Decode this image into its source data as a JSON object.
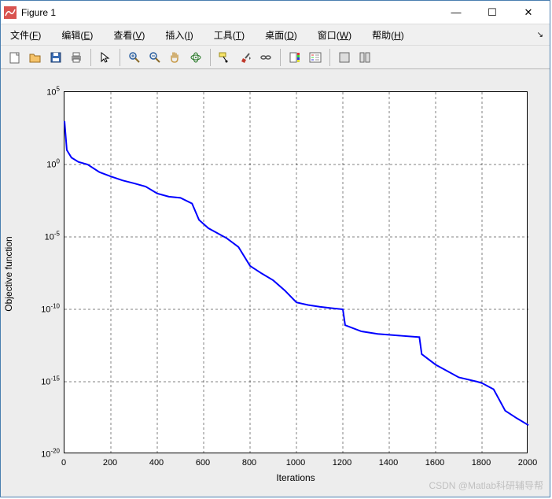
{
  "window": {
    "title": "Figure 1",
    "btn_min": "—",
    "btn_max": "☐",
    "btn_close": "✕"
  },
  "menu": {
    "file": "文件(F)",
    "edit": "编辑(E)",
    "view": "查看(V)",
    "insert": "插入(I)",
    "tools": "工具(T)",
    "desktop": "桌面(D)",
    "window": "窗口(W)",
    "help": "帮助(H)",
    "arrow": "↘"
  },
  "toolbar_icons": {
    "new": "new-icon",
    "open": "open-icon",
    "save": "save-icon",
    "print": "print-icon",
    "pointer": "pointer-icon",
    "zoomin": "zoom-in-icon",
    "zoomout": "zoom-out-icon",
    "pan": "pan-icon",
    "rotate": "rotate-icon",
    "datacursor": "data-cursor-icon",
    "brush": "brush-icon",
    "link": "link-icon",
    "colorbar": "colorbar-icon",
    "legend": "legend-icon",
    "hide": "hide-icon",
    "show": "show-icon"
  },
  "chart_data": {
    "type": "line",
    "title": "",
    "xlabel": "Iterations",
    "ylabel": "Objective function",
    "xlim": [
      0,
      2000
    ],
    "ylim": [
      1e-20,
      100000.0
    ],
    "xticks": [
      0,
      200,
      400,
      600,
      800,
      1000,
      1200,
      1400,
      1600,
      1800,
      2000
    ],
    "yticks_exp": [
      5,
      0,
      -5,
      -10,
      -15,
      -20
    ],
    "yscale": "log",
    "grid": true,
    "series_color": "#0000ff",
    "series": [
      {
        "x": 0,
        "y": 1000.0
      },
      {
        "x": 10,
        "y": 10.0
      },
      {
        "x": 30,
        "y": 3.0
      },
      {
        "x": 60,
        "y": 1.5
      },
      {
        "x": 100,
        "y": 1.0
      },
      {
        "x": 150,
        "y": 0.3
      },
      {
        "x": 200,
        "y": 0.15
      },
      {
        "x": 250,
        "y": 0.08
      },
      {
        "x": 300,
        "y": 0.05
      },
      {
        "x": 350,
        "y": 0.03
      },
      {
        "x": 400,
        "y": 0.01
      },
      {
        "x": 450,
        "y": 0.006
      },
      {
        "x": 500,
        "y": 0.005
      },
      {
        "x": 550,
        "y": 0.002
      },
      {
        "x": 580,
        "y": 0.00015
      },
      {
        "x": 620,
        "y": 4e-05
      },
      {
        "x": 700,
        "y": 8e-06
      },
      {
        "x": 750,
        "y": 2e-06
      },
      {
        "x": 800,
        "y": 1e-07
      },
      {
        "x": 850,
        "y": 3e-08
      },
      {
        "x": 900,
        "y": 1e-08
      },
      {
        "x": 950,
        "y": 2e-09
      },
      {
        "x": 1000,
        "y": 3e-10
      },
      {
        "x": 1050,
        "y": 2e-10
      },
      {
        "x": 1100,
        "y": 1.5e-10
      },
      {
        "x": 1150,
        "y": 1.2e-10
      },
      {
        "x": 1200,
        "y": 1e-10
      },
      {
        "x": 1210,
        "y": 8e-12
      },
      {
        "x": 1280,
        "y": 3e-12
      },
      {
        "x": 1350,
        "y": 2e-12
      },
      {
        "x": 1450,
        "y": 1.5e-12
      },
      {
        "x": 1530,
        "y": 1.2e-12
      },
      {
        "x": 1540,
        "y": 8e-14
      },
      {
        "x": 1600,
        "y": 1.5e-14
      },
      {
        "x": 1700,
        "y": 2e-15
      },
      {
        "x": 1780,
        "y": 1e-15
      },
      {
        "x": 1800,
        "y": 8e-16
      },
      {
        "x": 1850,
        "y": 3e-16
      },
      {
        "x": 1900,
        "y": 1e-17
      },
      {
        "x": 1950,
        "y": 3e-18
      },
      {
        "x": 2000,
        "y": 1e-18
      }
    ]
  },
  "watermark": "CSDN @Matlab科研辅导帮"
}
